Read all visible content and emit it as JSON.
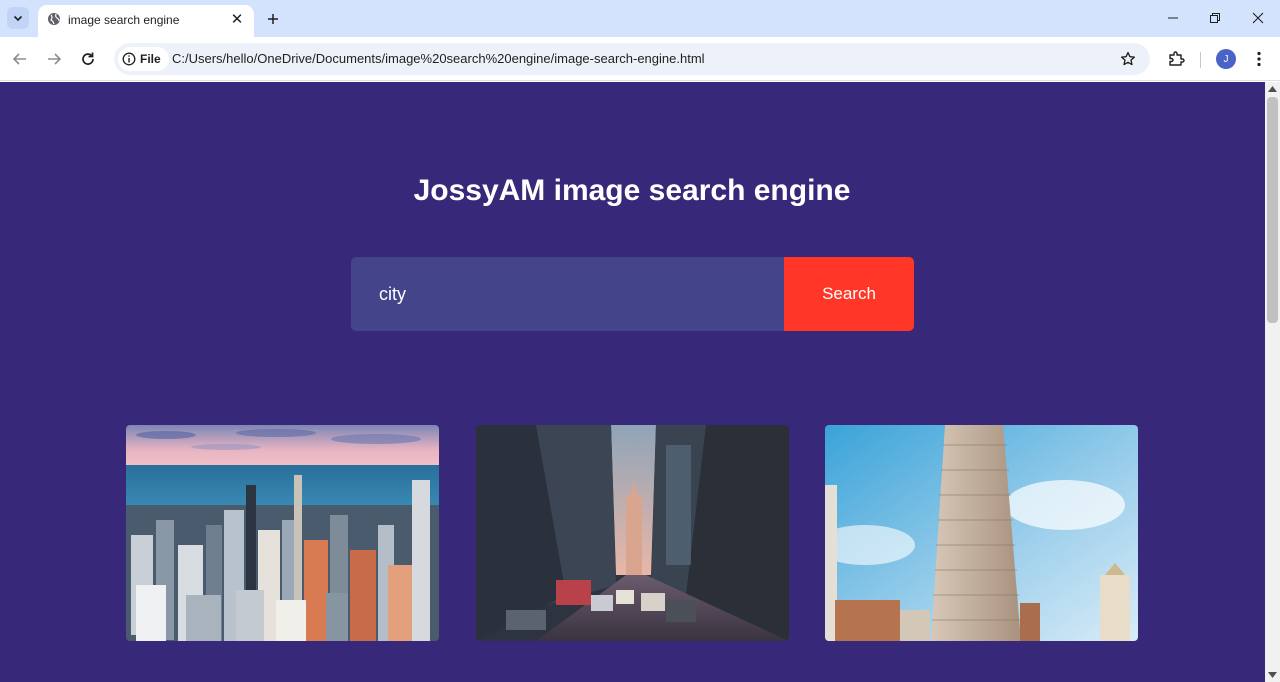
{
  "browser": {
    "tab_title": "image search engine",
    "address_chip": "File",
    "url": "C:/Users/hello/OneDrive/Documents/image%20search%20engine/image-search-engine.html",
    "profile_initial": "J"
  },
  "page": {
    "title": "JossyAM image search engine",
    "search_value": "city",
    "search_button": "Search"
  },
  "colors": {
    "background": "#38287a",
    "input_bg": "#44448a",
    "button_bg": "#ff3628"
  }
}
